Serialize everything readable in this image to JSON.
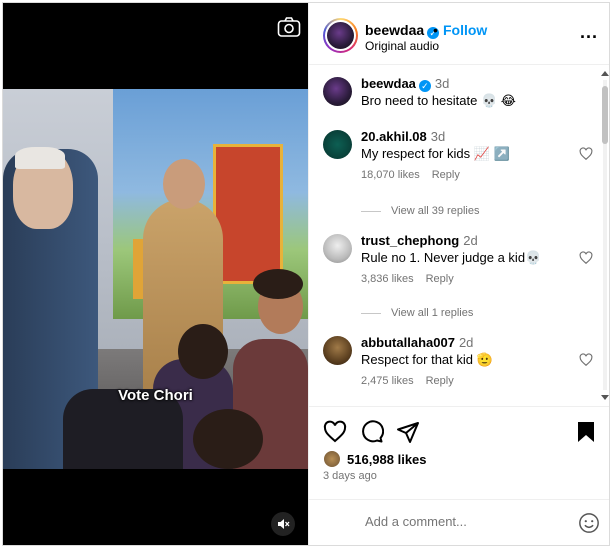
{
  "video": {
    "caption": "Vote Chori",
    "icons": {
      "camera": "camera-icon",
      "mute": "speaker-muted-icon"
    }
  },
  "header": {
    "username": "beewdaa",
    "separator": "•",
    "follow_label": "Follow",
    "subtitle": "Original audio",
    "more": "..."
  },
  "comments": [
    {
      "username": "beewdaa",
      "time": "3d",
      "text": "Bro need to hesitate 💀 😂",
      "likes": "",
      "reply": ""
    },
    {
      "username": "20.akhil.08",
      "time": "3d",
      "text": "My respect for kids 📈 ↗️",
      "likes": "18,070 likes",
      "reply": "Reply",
      "view_replies": "View all 39 replies"
    },
    {
      "username": "trust_chephong",
      "time": "2d",
      "text": "Rule no 1. Never judge a kid💀",
      "likes": "3,836 likes",
      "reply": "Reply",
      "view_replies": "View all 1 replies"
    },
    {
      "username": "abbutallaha007",
      "time": "2d",
      "text": "Respect for that kid 🫡",
      "likes": "2,475 likes",
      "reply": "Reply"
    }
  ],
  "actions": {
    "like_count": "516,988 likes",
    "posted": "3 days ago"
  },
  "add_comment": {
    "placeholder": "Add a comment..."
  },
  "colors": {
    "link_blue": "#0095f6",
    "muted_text": "#737373",
    "border": "#efefef"
  }
}
